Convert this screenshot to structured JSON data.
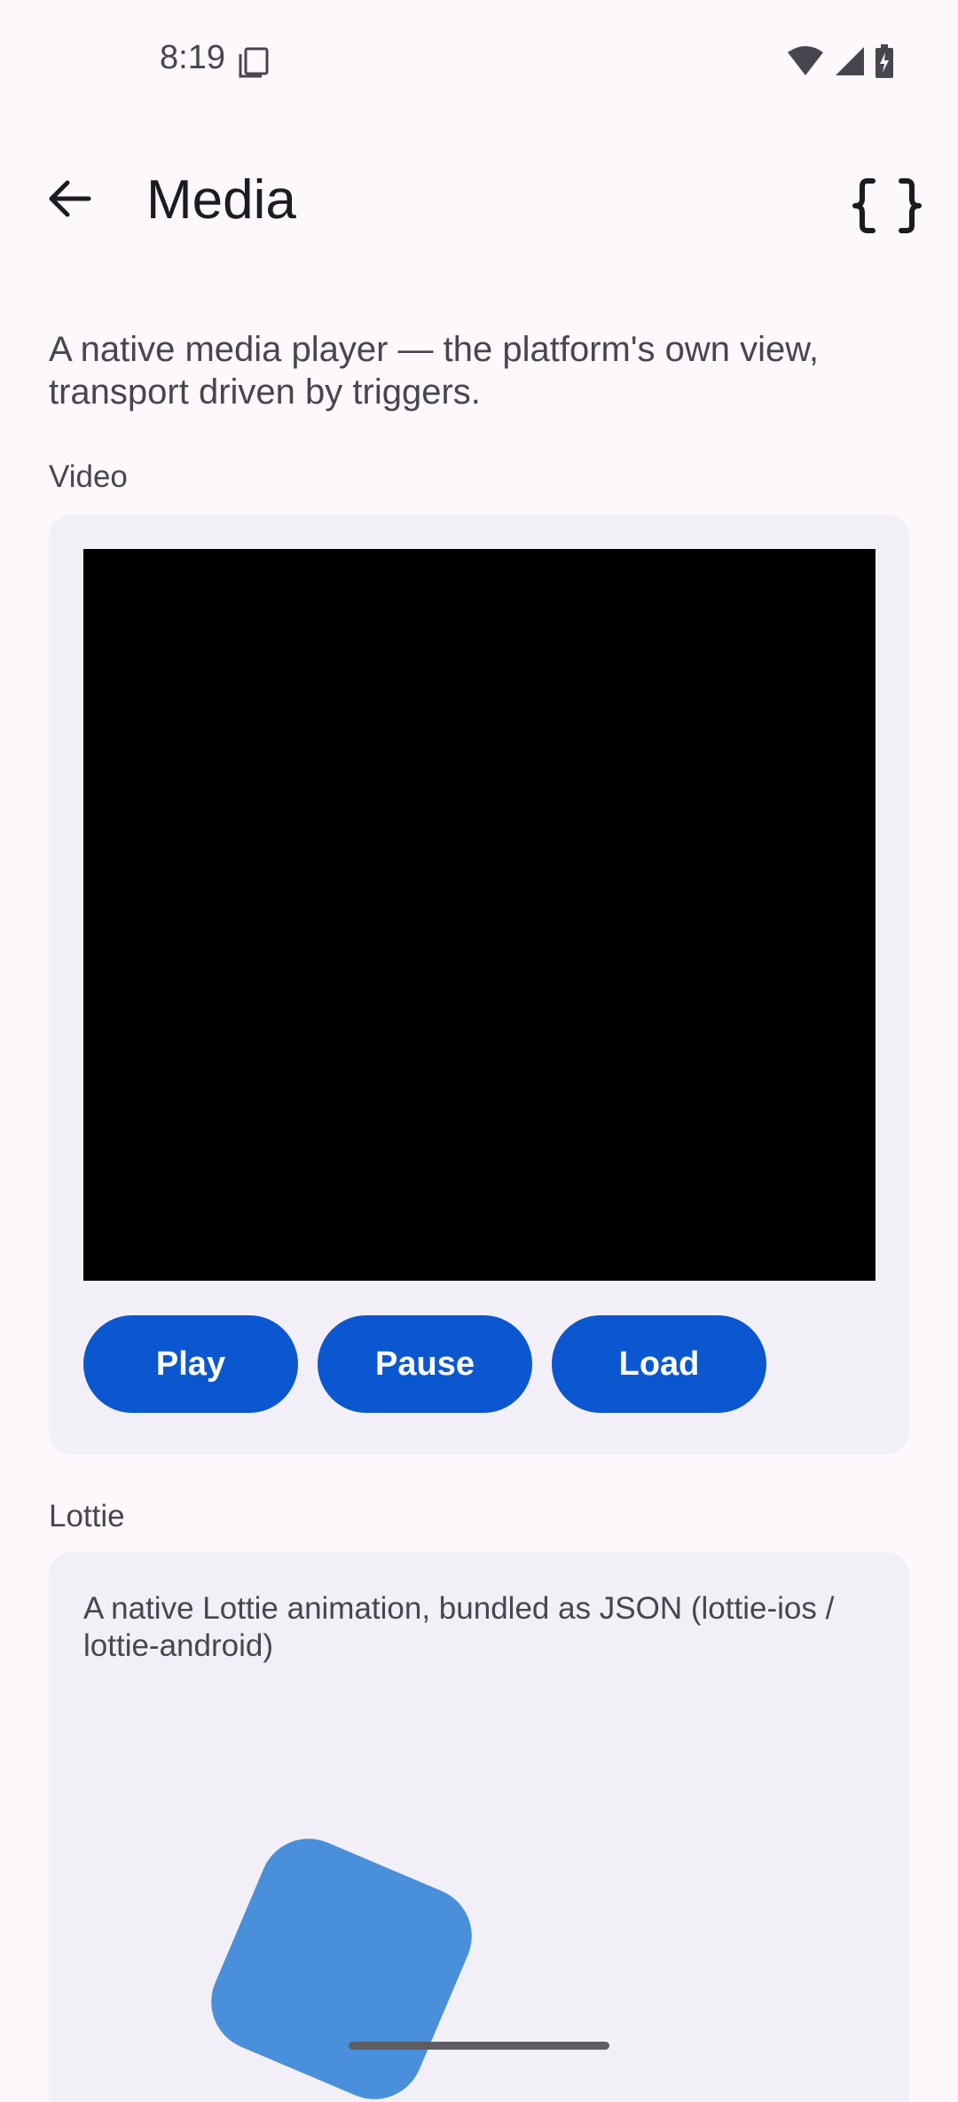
{
  "status_bar": {
    "time": "8:19",
    "icons": [
      "sim-card-icon",
      "wifi-icon",
      "cellular-signal-icon",
      "battery-charging-icon"
    ]
  },
  "app_bar": {
    "title": "Media",
    "back_icon": "arrow-back-icon",
    "action_icon": "braces-code-icon"
  },
  "description": "A native media player — the platform's own view, transport driven by triggers.",
  "video_section": {
    "label": "Video",
    "buttons": {
      "play": "Play",
      "pause": "Pause",
      "load": "Load"
    }
  },
  "lottie_section": {
    "label": "Lottie",
    "description": "A native Lottie animation, bundled as JSON (lottie-ios / lottie-android)"
  },
  "colors": {
    "background": "#fdf8fc",
    "card": "#f2eff6",
    "primary_button": "#0b57d0",
    "lottie_shape": "#4a8fd9"
  }
}
